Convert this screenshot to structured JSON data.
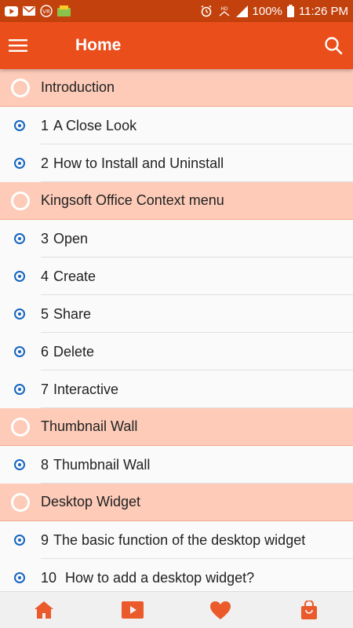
{
  "status_bar": {
    "battery": "100%",
    "time": "11:26 PM",
    "icons": [
      "youtube-icon",
      "mail-icon",
      "vpn-icon",
      "app-icon",
      "alarm-icon",
      "hd-icon",
      "signal-icon",
      "battery-icon"
    ]
  },
  "app_bar": {
    "title": "Home",
    "menu_icon": "hamburger-menu-icon",
    "search_icon": "search-icon"
  },
  "list": {
    "items": [
      {
        "type": "section",
        "number": "",
        "label": "Introduction"
      },
      {
        "type": "lesson",
        "number": "1",
        "label": "A Close Look"
      },
      {
        "type": "lesson",
        "number": "2",
        "label": "How to Install and Uninstall"
      },
      {
        "type": "section",
        "number": "",
        "label": "Kingsoft Office Context menu"
      },
      {
        "type": "lesson",
        "number": "3",
        "label": "Open"
      },
      {
        "type": "lesson",
        "number": "4",
        "label": "Create"
      },
      {
        "type": "lesson",
        "number": "5",
        "label": "Share"
      },
      {
        "type": "lesson",
        "number": "6",
        "label": "Delete"
      },
      {
        "type": "lesson",
        "number": "7",
        "label": "Interactive"
      },
      {
        "type": "section",
        "number": "",
        "label": "Thumbnail Wall"
      },
      {
        "type": "lesson",
        "number": "8",
        "label": "Thumbnail Wall"
      },
      {
        "type": "section",
        "number": "",
        "label": "Desktop Widget"
      },
      {
        "type": "lesson",
        "number": "9",
        "label": "The basic function of the desktop widget"
      },
      {
        "type": "lesson",
        "number": "10",
        "label": " How to add a desktop widget?"
      }
    ]
  },
  "bottom_nav": {
    "items": [
      "home-icon",
      "video-icon",
      "heart-icon",
      "shopping-bag-icon"
    ]
  },
  "colors": {
    "status_bar": "#c2410c",
    "app_bar": "#ea4e1b",
    "section_bg": "#fdcbb8",
    "bullet": "#1565c0",
    "nav_icon": "#ea5a2a"
  }
}
